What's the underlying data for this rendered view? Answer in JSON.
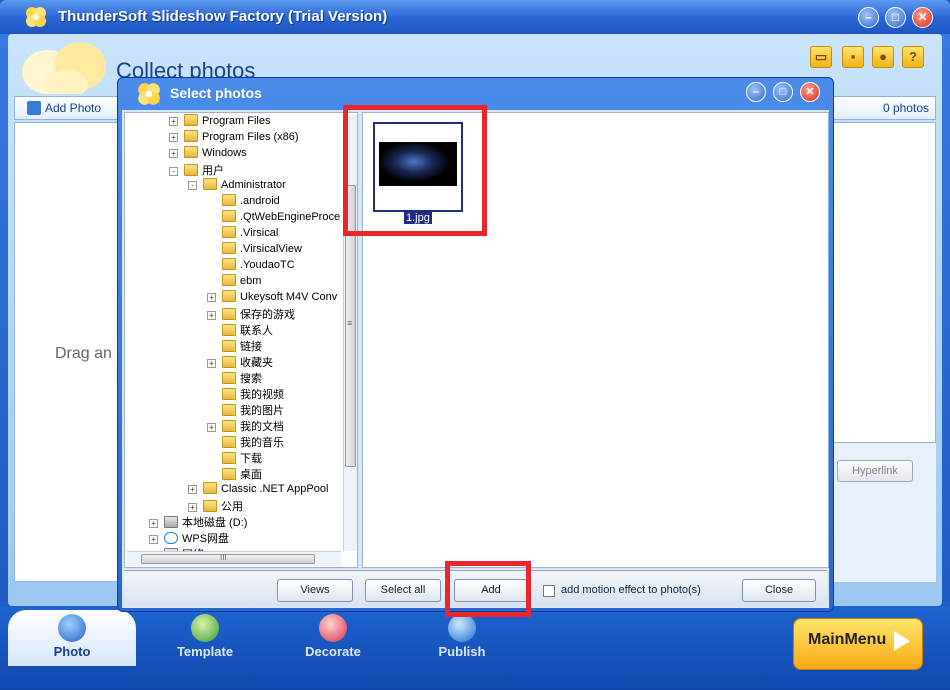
{
  "app": {
    "title": "ThunderSoft Slideshow Factory (Trial Version)",
    "heading": "Collect photos",
    "add_photo": "Add Photo",
    "photo_count": "0 photos",
    "drag_hint": "Drag an",
    "hyperlink": "Hyperlink",
    "tabs": [
      {
        "label": "Photo"
      },
      {
        "label": "Template"
      },
      {
        "label": "Decorate"
      },
      {
        "label": "Publish"
      }
    ],
    "main_menu": "MainMenu",
    "window_buttons": {
      "minimize": "–",
      "restore": "□",
      "close": "✕"
    },
    "toolbar_icons": [
      "folder-icon",
      "save-icon",
      "bulb-icon",
      "help-icon"
    ]
  },
  "dialog": {
    "title": "Select photos",
    "tree": [
      {
        "label": "Program Files",
        "indent": 0,
        "exp": "+"
      },
      {
        "label": "Program Files (x86)",
        "indent": 0,
        "exp": "+"
      },
      {
        "label": "Windows",
        "indent": 0,
        "exp": "+"
      },
      {
        "label": "用户",
        "indent": 0,
        "exp": "-"
      },
      {
        "label": "Administrator",
        "indent": 1,
        "exp": "-"
      },
      {
        "label": ".android",
        "indent": 2,
        "exp": ""
      },
      {
        "label": ".QtWebEngineProce",
        "indent": 2,
        "exp": ""
      },
      {
        "label": ".Virsical",
        "indent": 2,
        "exp": ""
      },
      {
        "label": ".VirsicalView",
        "indent": 2,
        "exp": ""
      },
      {
        "label": ".YoudaoTC",
        "indent": 2,
        "exp": ""
      },
      {
        "label": "ebm",
        "indent": 2,
        "exp": ""
      },
      {
        "label": "Ukeysoft M4V Conv",
        "indent": 2,
        "exp": "+"
      },
      {
        "label": "保存的游戏",
        "indent": 2,
        "exp": "+"
      },
      {
        "label": "联系人",
        "indent": 2,
        "exp": ""
      },
      {
        "label": "链接",
        "indent": 2,
        "exp": ""
      },
      {
        "label": "收藏夹",
        "indent": 2,
        "exp": "+"
      },
      {
        "label": "搜索",
        "indent": 2,
        "exp": ""
      },
      {
        "label": "我的视频",
        "indent": 2,
        "exp": ""
      },
      {
        "label": "我的图片",
        "indent": 2,
        "exp": ""
      },
      {
        "label": "我的文档",
        "indent": 2,
        "exp": "+"
      },
      {
        "label": "我的音乐",
        "indent": 2,
        "exp": ""
      },
      {
        "label": "下载",
        "indent": 2,
        "exp": ""
      },
      {
        "label": "桌面",
        "indent": 2,
        "exp": ""
      },
      {
        "label": "Classic .NET AppPool",
        "indent": 1,
        "exp": "+"
      },
      {
        "label": "公用",
        "indent": 1,
        "exp": "+"
      },
      {
        "label": "本地磁盘 (D:)",
        "indent": -1,
        "exp": "+",
        "kind": "drive"
      },
      {
        "label": "WPS网盘",
        "indent": -1,
        "exp": "+",
        "kind": "cloud"
      },
      {
        "label": "网络",
        "indent": -1,
        "exp": "+",
        "kind": "drive"
      }
    ],
    "file": {
      "name": "1.jpg"
    },
    "buttons": {
      "views": "Views",
      "select_all": "Select all",
      "add": "Add",
      "close": "Close"
    },
    "motion_label": "add motion effect to photo(s)",
    "hscroll_grip": "III",
    "vscroll_grip": "≡"
  },
  "colors": {
    "highlight": "#e8262b",
    "title_bar": "#2a67d5"
  }
}
